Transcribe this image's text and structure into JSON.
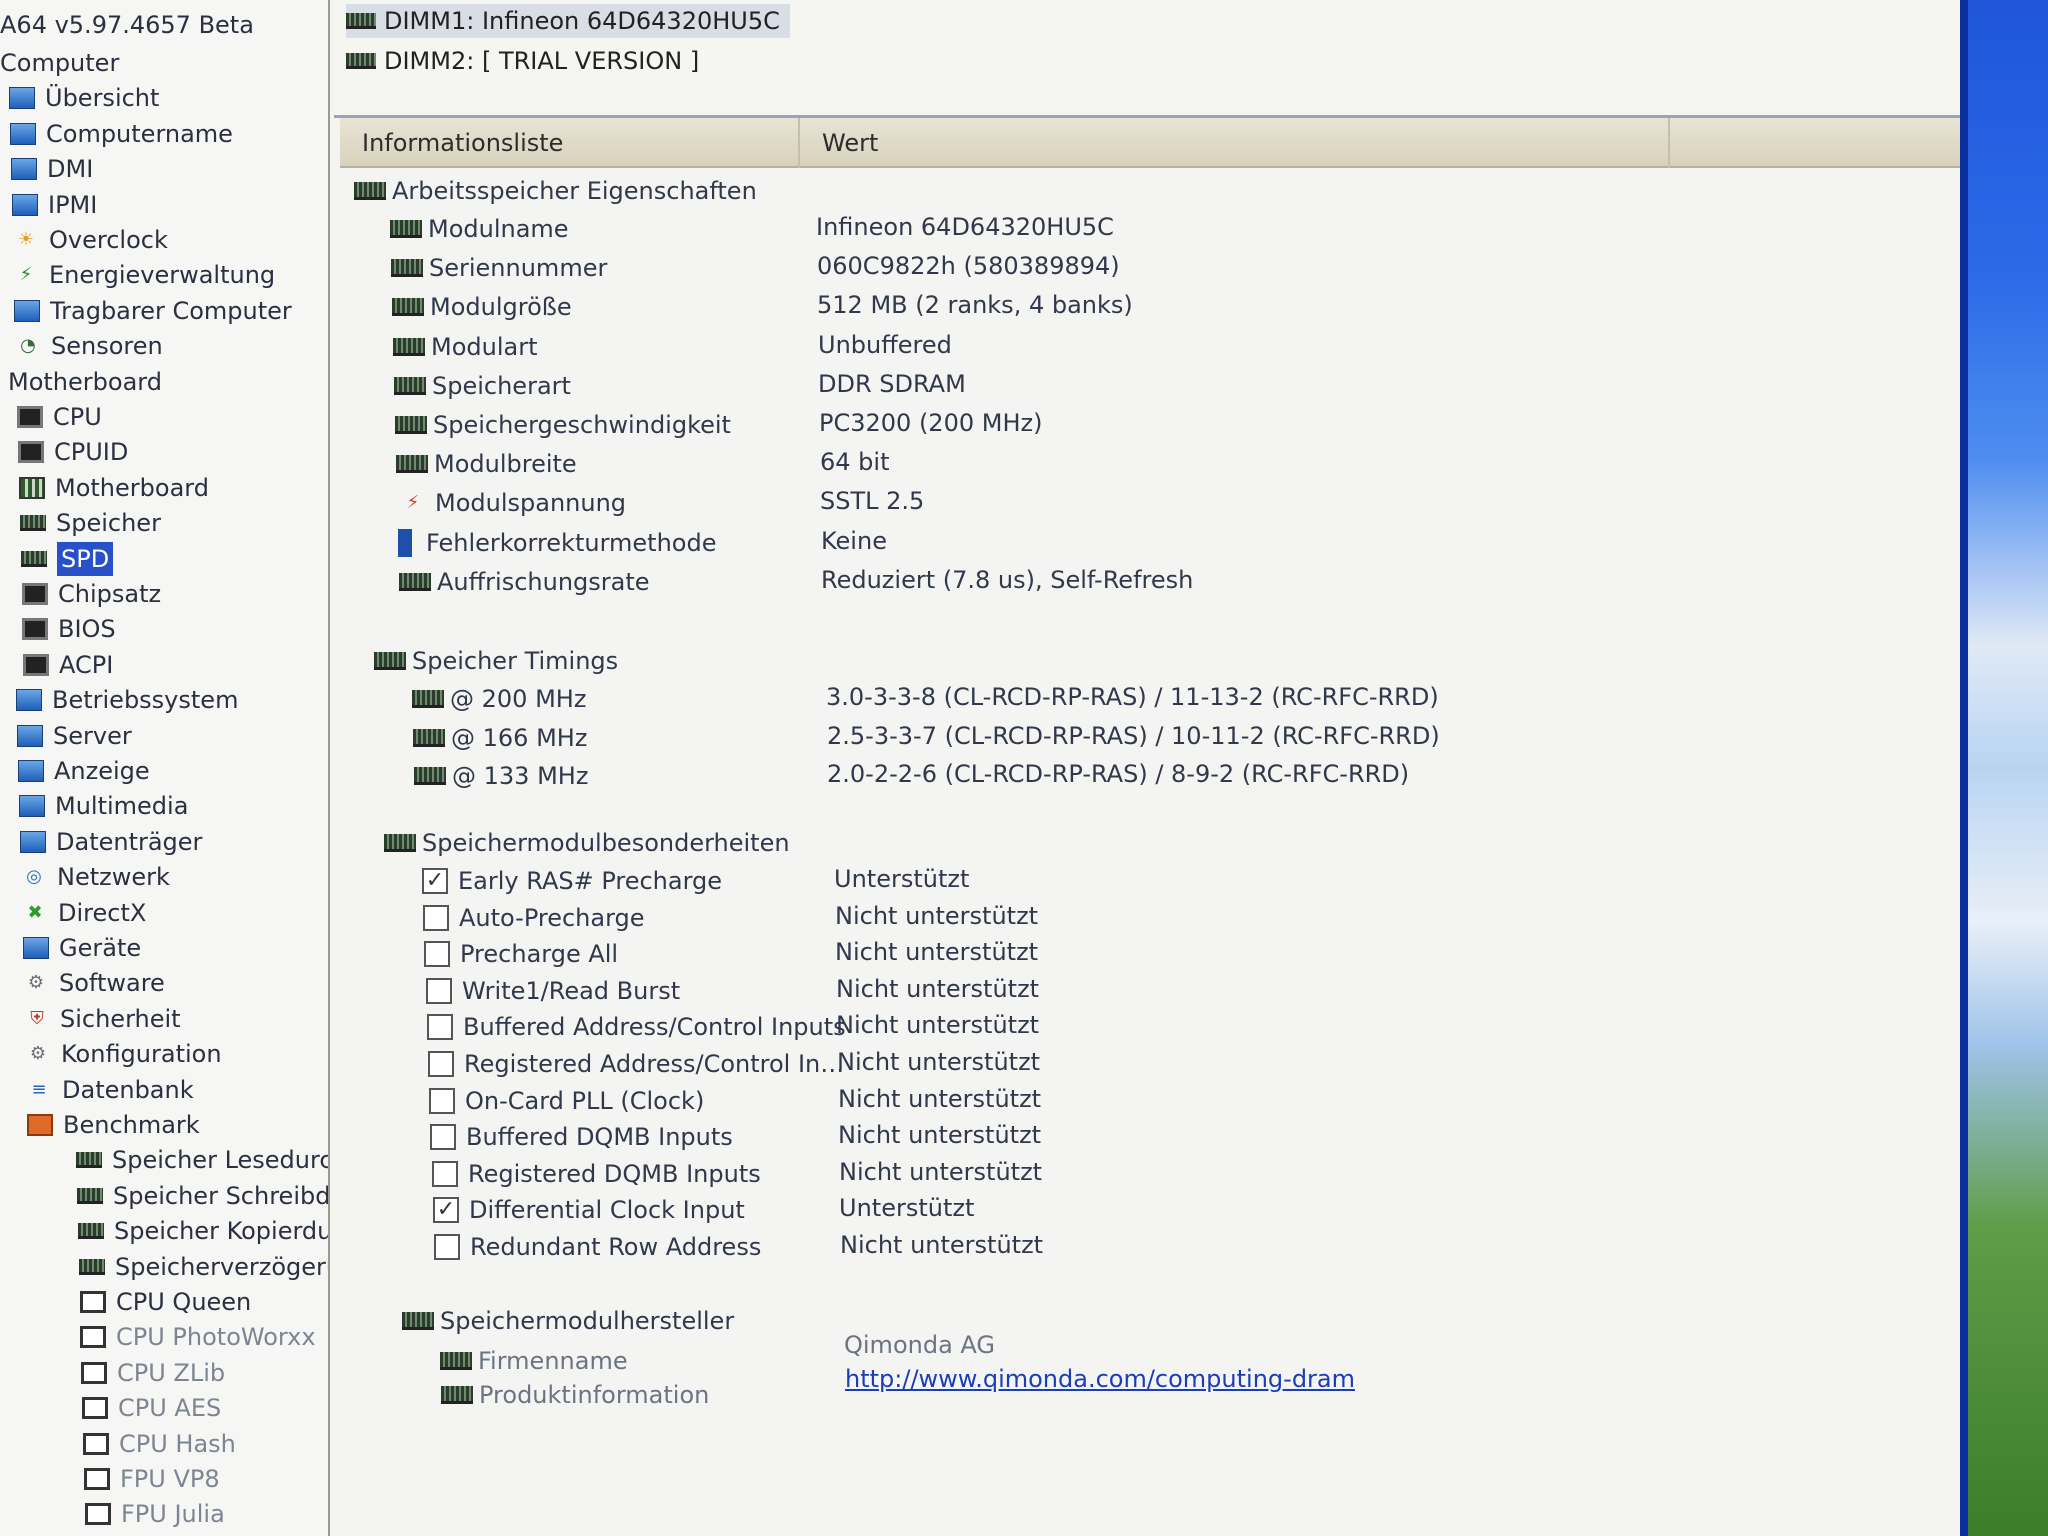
{
  "app_title": "A64 v5.97.4657 Beta",
  "tree": [
    {
      "label": "Computer",
      "icon": "none",
      "indent": 0
    },
    {
      "label": "Übersicht",
      "icon": "pc",
      "indent": 1
    },
    {
      "label": "Computername",
      "icon": "pc",
      "indent": 1
    },
    {
      "label": "DMI",
      "icon": "pc",
      "indent": 1
    },
    {
      "label": "IPMI",
      "icon": "pc",
      "indent": 1
    },
    {
      "label": "Overclock",
      "icon": "flame",
      "indent": 1
    },
    {
      "label": "Energieverwaltung",
      "icon": "plug",
      "indent": 1
    },
    {
      "label": "Tragbarer Computer",
      "icon": "pc",
      "indent": 1
    },
    {
      "label": "Sensoren",
      "icon": "gauge",
      "indent": 1
    },
    {
      "label": "Motherboard",
      "icon": "none",
      "indent": 0
    },
    {
      "label": "CPU",
      "icon": "chip",
      "indent": 1
    },
    {
      "label": "CPUID",
      "icon": "chip",
      "indent": 1
    },
    {
      "label": "Motherboard",
      "icon": "board",
      "indent": 1
    },
    {
      "label": "Speicher",
      "icon": "ram",
      "indent": 1
    },
    {
      "label": "SPD",
      "icon": "ram",
      "indent": 1,
      "selected": true
    },
    {
      "label": "Chipsatz",
      "icon": "chip",
      "indent": 1
    },
    {
      "label": "BIOS",
      "icon": "chip",
      "indent": 1
    },
    {
      "label": "ACPI",
      "icon": "chip",
      "indent": 1
    },
    {
      "label": "Betriebssystem",
      "icon": "pc",
      "indent": 0
    },
    {
      "label": "Server",
      "icon": "pc",
      "indent": 0
    },
    {
      "label": "Anzeige",
      "icon": "pc",
      "indent": 0
    },
    {
      "label": "Multimedia",
      "icon": "pc",
      "indent": 0
    },
    {
      "label": "Datenträger",
      "icon": "pc",
      "indent": 0
    },
    {
      "label": "Netzwerk",
      "icon": "globe",
      "indent": 0
    },
    {
      "label": "DirectX",
      "icon": "x",
      "indent": 0
    },
    {
      "label": "Geräte",
      "icon": "pc",
      "indent": 0
    },
    {
      "label": "Software",
      "icon": "gear",
      "indent": 0
    },
    {
      "label": "Sicherheit",
      "icon": "shield",
      "indent": 0
    },
    {
      "label": "Konfiguration",
      "icon": "gear",
      "indent": 0
    },
    {
      "label": "Datenbank",
      "icon": "db",
      "indent": 0
    },
    {
      "label": "Benchmark",
      "icon": "bench",
      "indent": 0
    },
    {
      "label": "Speicher Lesedurchsatz",
      "icon": "ram",
      "indent": 1
    },
    {
      "label": "Speicher Schreibdurchsatz",
      "icon": "ram",
      "indent": 1
    },
    {
      "label": "Speicher Kopierdurchsatz",
      "icon": "ram",
      "indent": 1
    },
    {
      "label": "Speicherverzögerung",
      "icon": "ram",
      "indent": 1
    },
    {
      "label": "CPU Queen",
      "icon": "box",
      "indent": 1
    },
    {
      "label": "CPU PhotoWorxx",
      "icon": "box",
      "indent": 1
    },
    {
      "label": "CPU ZLib",
      "icon": "box",
      "indent": 1
    },
    {
      "label": "CPU AES",
      "icon": "box",
      "indent": 1
    },
    {
      "label": "CPU Hash",
      "icon": "box",
      "indent": 1
    },
    {
      "label": "FPU VP8",
      "icon": "box",
      "indent": 1
    },
    {
      "label": "FPU Julia",
      "icon": "box",
      "indent": 1
    }
  ],
  "devices": [
    {
      "label": "DIMM1: Infineon 64D64320HU5C",
      "selected": true
    },
    {
      "label": "DIMM2: [ TRIAL VERSION ]",
      "selected": false
    }
  ],
  "columns": {
    "field": "Informationsliste",
    "value": "Wert"
  },
  "sections": {
    "props": {
      "title": "Arbeitsspeicher Eigenschaften",
      "rows": [
        {
          "field": "Modulname",
          "value": "Infineon 64D64320HU5C"
        },
        {
          "field": "Seriennummer",
          "value": "060C9822h (580389894)"
        },
        {
          "field": "Modulgröße",
          "value": "512 MB (2 ranks, 4 banks)"
        },
        {
          "field": "Modulart",
          "value": "Unbuffered"
        },
        {
          "field": "Speicherart",
          "value": "DDR SDRAM"
        },
        {
          "field": "Speichergeschwindigkeit",
          "value": "PC3200 (200 MHz)"
        },
        {
          "field": "Modulbreite",
          "value": "64 bit"
        },
        {
          "field": "Modulspannung",
          "value": "SSTL 2.5"
        },
        {
          "field": "Fehlerkorrekturmethode",
          "value": "Keine"
        },
        {
          "field": "Auffrischungsrate",
          "value": "Reduziert (7.8 us), Self-Refresh"
        }
      ]
    },
    "timings": {
      "title": "Speicher Timings",
      "rows": [
        {
          "field": "@ 200 MHz",
          "value": "3.0-3-3-8  (CL-RCD-RP-RAS) / 11-13-2  (RC-RFC-RRD)"
        },
        {
          "field": "@ 166 MHz",
          "value": "2.5-3-3-7  (CL-RCD-RP-RAS) / 10-11-2  (RC-RFC-RRD)"
        },
        {
          "field": "@ 133 MHz",
          "value": "2.0-2-2-6  (CL-RCD-RP-RAS) / 8-9-2  (RC-RFC-RRD)"
        }
      ]
    },
    "features": {
      "title": "Speichermodulbesonderheiten",
      "rows": [
        {
          "field": "Early RAS# Precharge",
          "value": "Unterstützt",
          "checked": true
        },
        {
          "field": "Auto-Precharge",
          "value": "Nicht unterstützt",
          "checked": false
        },
        {
          "field": "Precharge All",
          "value": "Nicht unterstützt",
          "checked": false
        },
        {
          "field": "Write1/Read Burst",
          "value": "Nicht unterstützt",
          "checked": false
        },
        {
          "field": "Buffered Address/Control Inputs",
          "value": "Nicht unterstützt",
          "checked": false
        },
        {
          "field": "Registered Address/Control In…",
          "value": "Nicht unterstützt",
          "checked": false
        },
        {
          "field": "On-Card PLL (Clock)",
          "value": "Nicht unterstützt",
          "checked": false
        },
        {
          "field": "Buffered DQMB Inputs",
          "value": "Nicht unterstützt",
          "checked": false
        },
        {
          "field": "Registered DQMB Inputs",
          "value": "Nicht unterstützt",
          "checked": false
        },
        {
          "field": "Differential Clock Input",
          "value": "Unterstützt",
          "checked": true
        },
        {
          "field": "Redundant Row Address",
          "value": "Nicht unterstützt",
          "checked": false
        }
      ]
    },
    "manufacturer": {
      "title": "Speichermodulhersteller",
      "rows": [
        {
          "field": "Firmenname",
          "value": "Qimonda AG"
        },
        {
          "field": "Produktinformation",
          "value": "http://www.qimonda.com/computing-dram",
          "link": true
        }
      ]
    }
  }
}
